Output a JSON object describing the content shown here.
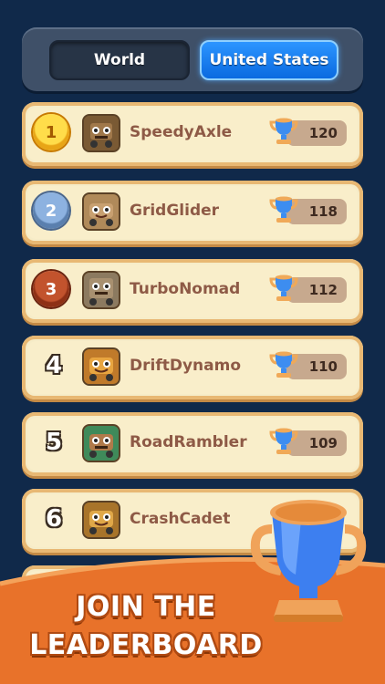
{
  "tabs": {
    "world": "World",
    "country": "United States"
  },
  "entries": [
    {
      "rank": "1",
      "name": "SpeedyAxle",
      "score": "120",
      "medal": "gold"
    },
    {
      "rank": "2",
      "name": "GridGlider",
      "score": "118",
      "medal": "silver"
    },
    {
      "rank": "3",
      "name": "TurboNomad",
      "score": "112",
      "medal": "bronze"
    },
    {
      "rank": "4",
      "name": "DriftDynamo",
      "score": "110",
      "medal": ""
    },
    {
      "rank": "5",
      "name": "RoadRambler",
      "score": "109",
      "medal": ""
    },
    {
      "rank": "6",
      "name": "CrashCadet",
      "score": "",
      "medal": ""
    }
  ],
  "banner": {
    "line1": "JOIN THE",
    "line2": "LEADERBOARD"
  },
  "colors": {
    "accent": "#1a7df0",
    "background": "#10294a",
    "row": "#f6ecc8",
    "banner": "#e8722a"
  }
}
